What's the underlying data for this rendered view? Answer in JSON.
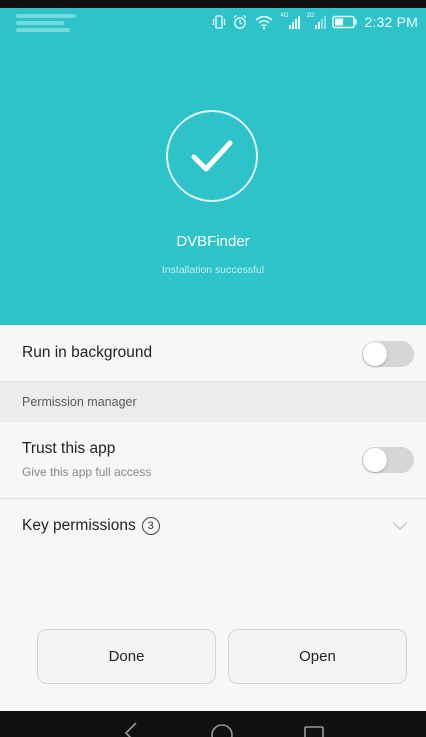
{
  "status_bar": {
    "time": "2:32 PM",
    "icons": [
      "vibrate-icon",
      "alarm-icon",
      "wifi-icon",
      "signal-4g-icon",
      "signal-2g-icon",
      "battery-icon"
    ],
    "network_labels": [
      "4G",
      "2G"
    ]
  },
  "install": {
    "app_name": "DVBFinder",
    "status": "Installation successful",
    "icon": "checkmark-icon"
  },
  "settings": {
    "run_in_background": {
      "label": "Run in background",
      "enabled": false
    },
    "section_header": "Permission manager",
    "trust_app": {
      "label": "Trust this app",
      "description": "Give this app full access",
      "enabled": false
    },
    "key_permissions": {
      "label": "Key permissions",
      "count": "3"
    }
  },
  "buttons": {
    "done": "Done",
    "open": "Open"
  },
  "navigation_bar": {
    "icons": [
      "back-icon",
      "home-icon",
      "recents-icon"
    ]
  },
  "colors": {
    "accent": "#2dc3c9",
    "toggle_off": "#d6d6d6",
    "list_background": "#f7f7f7",
    "section_background": "#ececec"
  }
}
